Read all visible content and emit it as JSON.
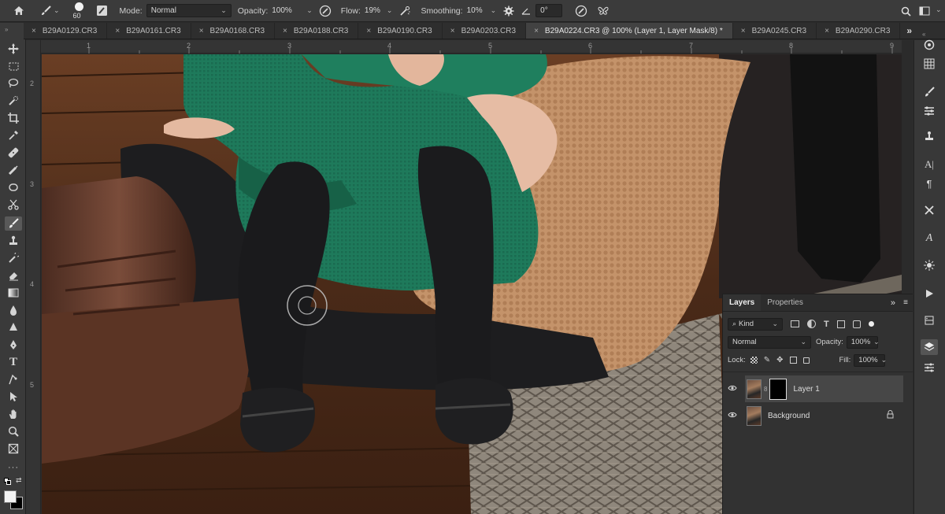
{
  "options_bar": {
    "brush_size": "60",
    "mode_label": "Mode:",
    "mode_value": "Normal",
    "opacity_label": "Opacity:",
    "opacity_value": "100%",
    "flow_label": "Flow:",
    "flow_value": "19%",
    "smoothing_label": "Smoothing:",
    "smoothing_value": "10%",
    "angle_value": "0°"
  },
  "tabs": [
    {
      "label": "B29A0129.CR3"
    },
    {
      "label": "B29A0161.CR3"
    },
    {
      "label": "B29A0168.CR3"
    },
    {
      "label": "B29A0188.CR3"
    },
    {
      "label": "B29A0190.CR3"
    },
    {
      "label": "B29A0203.CR3"
    },
    {
      "label": "B29A0224.CR3 @ 100% (Layer 1, Layer Mask/8) *"
    },
    {
      "label": "B29A0245.CR3"
    },
    {
      "label": "B29A0290.CR3"
    }
  ],
  "ruler_top": [
    "1",
    "2",
    "3",
    "4",
    "5",
    "6",
    "7",
    "8",
    "9"
  ],
  "ruler_left": [
    "2",
    "3",
    "4",
    "5"
  ],
  "layers_panel": {
    "tab_layers": "Layers",
    "tab_properties": "Properties",
    "kind_label": "Kind",
    "blend_mode": "Normal",
    "opacity_label": "Opacity:",
    "opacity_value": "100%",
    "lock_label": "Lock:",
    "fill_label": "Fill:",
    "fill_value": "100%",
    "layers": [
      {
        "name": "Layer 1"
      },
      {
        "name": "Background"
      }
    ]
  },
  "colors": {
    "ui_dark": "#2b2b2b",
    "panel": "#323232",
    "selected_layer": "#474747"
  }
}
